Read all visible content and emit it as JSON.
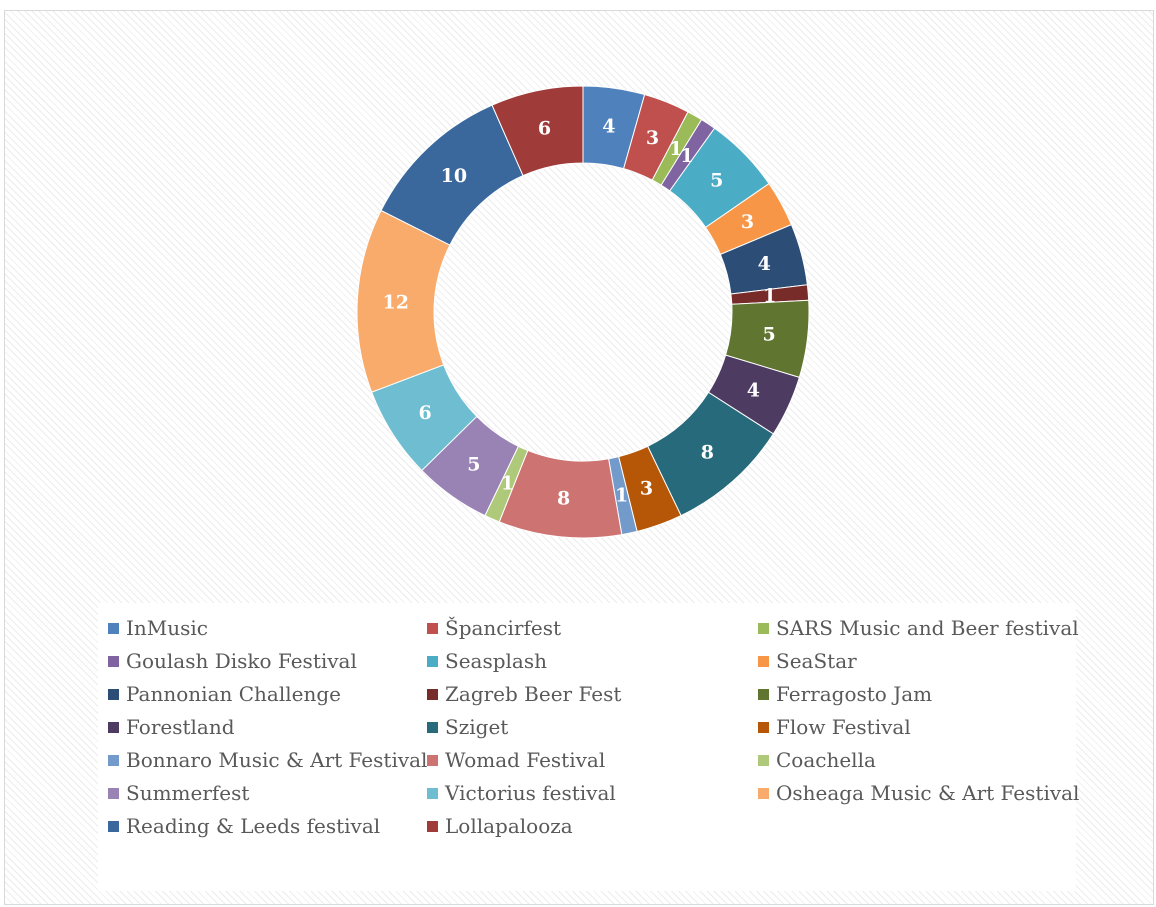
{
  "chart_data": {
    "type": "pie",
    "variant": "donut",
    "title": "",
    "categories": [
      "InMusic",
      "Špancirfest",
      "SARS Music and Beer festival",
      "Goulash Disko Festival",
      "Seasplash",
      "SeaStar",
      "Pannonian Challenge",
      "Zagreb Beer Fest",
      "Ferragosto Jam",
      "Forestland",
      "Sziget",
      "Flow Festival",
      "Bonnaro Music & Art Festival",
      "Womad Festival",
      "Coachella",
      "Summerfest",
      "Victorius festival",
      "Osheaga Music & Art Festival",
      "Reading & Leeds festival",
      "Lollapalooza"
    ],
    "values": [
      4,
      3,
      1,
      1,
      5,
      3,
      4,
      1,
      5,
      4,
      8,
      3,
      1,
      8,
      1,
      5,
      6,
      12,
      10,
      6
    ],
    "colors": [
      "#4f81bd",
      "#c0504d",
      "#9bbb59",
      "#8064a2",
      "#4bacc6",
      "#f79646",
      "#2c4d75",
      "#772c2a",
      "#5f7530",
      "#4d3b62",
      "#276a7c",
      "#b65708",
      "#729aca",
      "#cd7371",
      "#afc97a",
      "#9983b5",
      "#6fbdd1",
      "#f9ab6b",
      "#3a679c",
      "#9f3b38"
    ],
    "data_labels": true,
    "legend_position": "bottom",
    "background": "diagonal hatch"
  }
}
